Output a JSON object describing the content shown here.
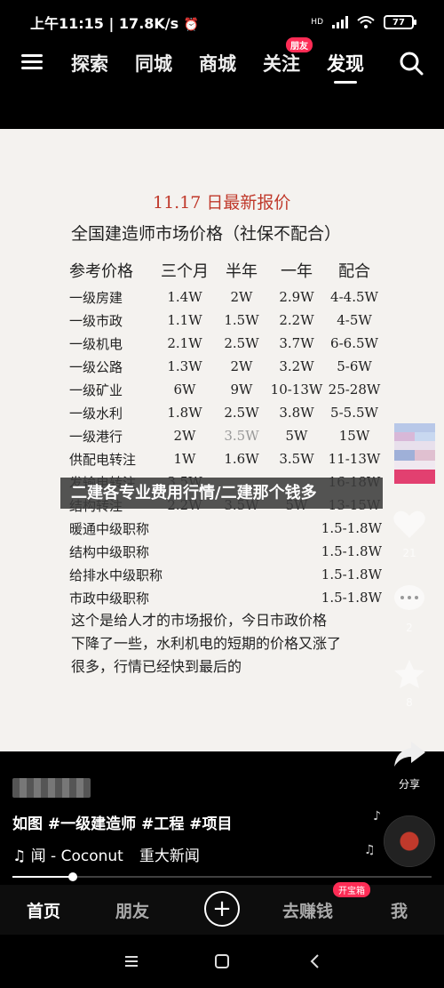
{
  "status_bar": {
    "time": "上午11:15",
    "net_speed": "17.8K/s",
    "network": "HD",
    "battery": "77"
  },
  "top_nav": {
    "tabs": [
      {
        "label": "探索"
      },
      {
        "label": "同城"
      },
      {
        "label": "商城"
      },
      {
        "label": "关注",
        "badge": "朋友"
      },
      {
        "label": "发现",
        "active": true
      }
    ]
  },
  "content": {
    "title": "11.17 日最新报价",
    "heading": "全国建造师市场价格（社保不配合）",
    "table": {
      "headers": [
        "参考价格",
        "三个月",
        "半年",
        "一年",
        "配合"
      ],
      "rows": [
        [
          "一级房建",
          "1.4W",
          "2W",
          "2.9W",
          "4-4.5W"
        ],
        [
          "一级市政",
          "1.1W",
          "1.5W",
          "2.2W",
          "4-5W"
        ],
        [
          "一级机电",
          "2.1W",
          "2.5W",
          "3.7W",
          "6-6.5W"
        ],
        [
          "一级公路",
          "1.3W",
          "2W",
          "3.2W",
          "5-6W"
        ],
        [
          "一级矿业",
          "6W",
          "9W",
          "10-13W",
          "25-28W"
        ],
        [
          "一级水利",
          "1.8W",
          "2.5W",
          "3.8W",
          "5-5.5W"
        ],
        [
          "一级港行",
          "2W",
          "3.5W",
          "5W",
          "15W"
        ],
        [
          "供配电转注",
          "1W",
          "1.6W",
          "3.5W",
          "11-13W"
        ],
        [
          "发输电转注",
          "3.5W",
          "",
          "",
          "16-18W"
        ],
        [
          "结构转注",
          "2.2W",
          "3.5W",
          "5W",
          "13-15W"
        ]
      ],
      "titled_rows": [
        {
          "name": "暖通中级职称",
          "price": "1.5-1.8W"
        },
        {
          "name": "结构中级职称",
          "price": "1.5-1.8W"
        },
        {
          "name": "给排水中级职称",
          "price": "1.5-1.8W"
        },
        {
          "name": "市政中级职称",
          "price": "1.5-1.8W"
        }
      ]
    },
    "note_lines": [
      "这个是给人才的市场报价，今日市政价格",
      "下降了一些，水利机电的短期的价格又涨了",
      "很多，行情已经快到最后的"
    ],
    "overlay_banner": "二建各专业费用行情/二建那个钱多"
  },
  "actions": {
    "like_count": "21",
    "comment_count": "2",
    "favorite_count": "8",
    "share_label": "分享"
  },
  "bottom_info": {
    "description": "如图 #一级建造师 #工程 #项目",
    "music_title": "♫ 闻 - Coconut",
    "music_extra": "重大新闻",
    "progress": 0.145
  },
  "tab_bar": {
    "home": "首页",
    "friends": "朋友",
    "plus": "+",
    "earn": "去赚钱",
    "earn_badge": "开宝箱",
    "me": "我"
  },
  "colors": {
    "accent": "#fe2c55",
    "title_red": "#c0392b",
    "paper": "#f4f2ef"
  }
}
